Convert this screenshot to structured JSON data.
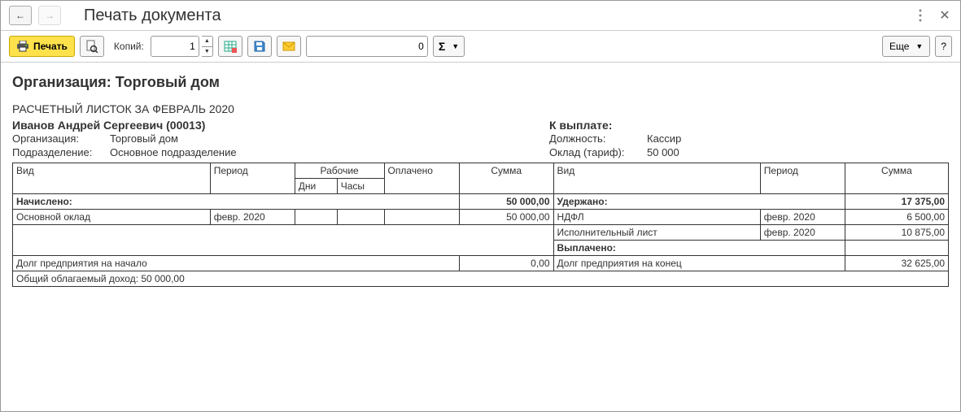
{
  "window": {
    "title": "Печать документа"
  },
  "toolbar": {
    "print_label": "Печать",
    "copies_label": "Копий:",
    "copies_value": "1",
    "page_value": "0",
    "more_label": "Еще",
    "help_label": "?"
  },
  "doc": {
    "org_header": "Организация: Торговый дом",
    "period_title": "РАСЧЕТНЫЙ ЛИСТОК ЗА ФЕВРАЛЬ 2020",
    "employee_name": "Иванов Андрей Сергеевич (00013)",
    "pay_header": "К выплате:",
    "left": [
      {
        "label": "Организация:",
        "value": "Торговый дом"
      },
      {
        "label": "Подразделение:",
        "value": "Основное подразделение"
      }
    ],
    "right": [
      {
        "label": "Должность:",
        "value": "Кассир"
      },
      {
        "label": "Оклад (тариф):",
        "value": "50 000"
      }
    ],
    "headers": {
      "vid": "Вид",
      "period": "Период",
      "work": "Рабочие",
      "days": "Дни",
      "hours": "Часы",
      "paid": "Оплачено",
      "sum": "Сумма"
    },
    "accrued": {
      "label": "Начислено:",
      "total": "50 000,00"
    },
    "accrued_rows": [
      {
        "vid": "Основной оклад",
        "period": "февр. 2020",
        "sum": "50 000,00"
      }
    ],
    "withheld": {
      "label": "Удержано:",
      "total": "17 375,00"
    },
    "withheld_rows": [
      {
        "vid": "НДФЛ",
        "period": "февр. 2020",
        "sum": "6 500,00",
        "highlight": false
      },
      {
        "vid": "Исполнительный лист",
        "period": "февр. 2020",
        "sum": "10 875,00",
        "highlight": true
      }
    ],
    "paid_out": {
      "label": "Выплачено:"
    },
    "debt_start": {
      "label": "Долг предприятия на начало",
      "value": "0,00"
    },
    "debt_end": {
      "label": "Долг предприятия на конец",
      "value": "32 625,00"
    },
    "taxable": "Общий облагаемый доход: 50 000,00"
  }
}
